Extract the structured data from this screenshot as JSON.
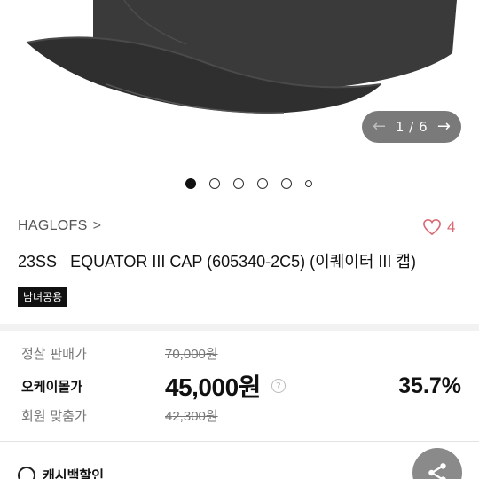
{
  "gallery": {
    "current": "1",
    "separator": "/",
    "total": "6",
    "prev_icon": "arrow-left-icon",
    "next_icon": "arrow-right-icon",
    "dot_count": 6,
    "active_index": 0
  },
  "product": {
    "brand": "HAGLOFS",
    "brand_chevron": ">",
    "like_count": "4",
    "season": "23SS",
    "name": "EQUATOR III CAP (605340-2C5) (이퀘이터 III 캡)",
    "badge": "남녀공용"
  },
  "pricing": {
    "list_label": "정찰 판매가",
    "list_price": "70,000원",
    "ok_label": "오케이몰가",
    "ok_price": "45,000원",
    "help_symbol": "?",
    "discount": "35.7%",
    "member_label": "회원 맞춤가",
    "member_price": "42,300원"
  },
  "footer": {
    "cashback_label": "캐시백할인",
    "share_icon": "share-icon"
  },
  "colors": {
    "like": "#d86a72",
    "counter_bg": "#7a7a7a",
    "share_bg": "#8a8a8a"
  }
}
